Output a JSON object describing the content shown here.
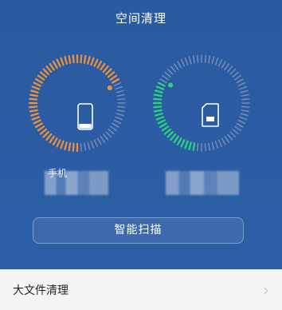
{
  "header": {
    "title": "空间清理"
  },
  "gauges": [
    {
      "id": "phone",
      "label_visible_prefix": "手机",
      "ring_fill_fraction": 0.68,
      "accent": "#f0923a",
      "icon": "phone-icon"
    },
    {
      "id": "sd",
      "label_visible_prefix": "",
      "ring_fill_fraction": 0.3,
      "accent": "#29d67a",
      "icon": "sd-card-icon"
    }
  ],
  "scan": {
    "button_label": "智能扫描"
  },
  "list": {
    "items": [
      {
        "label": "大文件清理",
        "chevron": "›"
      }
    ]
  },
  "colors": {
    "background": "#2c5ea3",
    "track": "#7d95bd"
  }
}
